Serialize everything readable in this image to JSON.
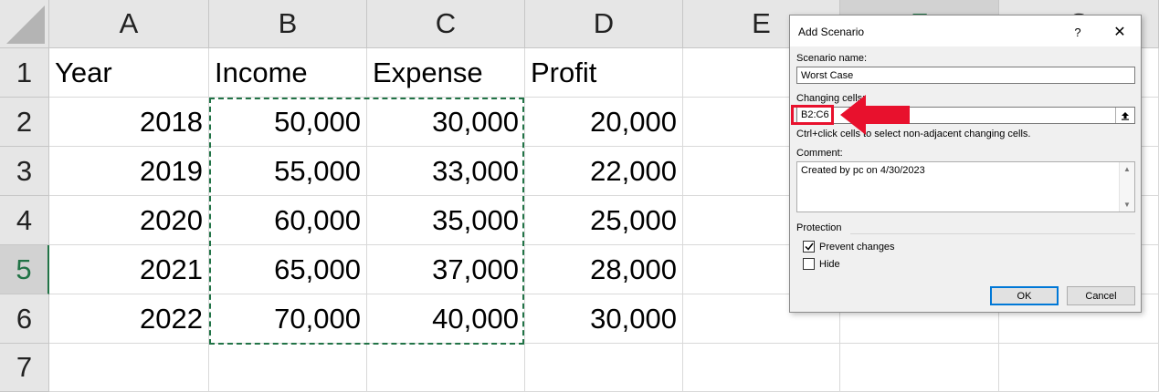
{
  "sheet": {
    "columns": [
      "A",
      "B",
      "C",
      "D",
      "E",
      "F",
      "G"
    ],
    "rows": [
      "1",
      "2",
      "3",
      "4",
      "5",
      "6",
      "7"
    ],
    "header": {
      "a": "Year",
      "b": "Income",
      "c": "Expense",
      "d": "Profit"
    },
    "data": [
      {
        "year": "2018",
        "income": "50,000",
        "expense": "30,000",
        "profit": "20,000"
      },
      {
        "year": "2019",
        "income": "55,000",
        "expense": "33,000",
        "profit": "22,000"
      },
      {
        "year": "2020",
        "income": "60,000",
        "expense": "35,000",
        "profit": "25,000"
      },
      {
        "year": "2021",
        "income": "65,000",
        "expense": "37,000",
        "profit": "28,000"
      },
      {
        "year": "2022",
        "income": "70,000",
        "expense": "40,000",
        "profit": "30,000"
      }
    ],
    "selected_row": "5",
    "accent_color": "#217346"
  },
  "dialog": {
    "title": "Add Scenario",
    "help_glyph": "?",
    "close_glyph": "✕",
    "scenario_name_label": "Scenario name:",
    "scenario_name_value": "Worst Case",
    "changing_cells_label": "Changing cells:",
    "changing_cells_value": "B2:C6",
    "hint": "Ctrl+click cells to select non-adjacent changing cells.",
    "comment_label": "Comment:",
    "comment_value": "Created by pc on 4/30/2023",
    "protection_label": "Protection",
    "prevent_changes_label": "Prevent changes",
    "prevent_changes_checked": true,
    "hide_label": "Hide",
    "hide_checked": false,
    "ok_label": "OK",
    "cancel_label": "Cancel"
  },
  "annotation": {
    "color": "#e8112d"
  }
}
